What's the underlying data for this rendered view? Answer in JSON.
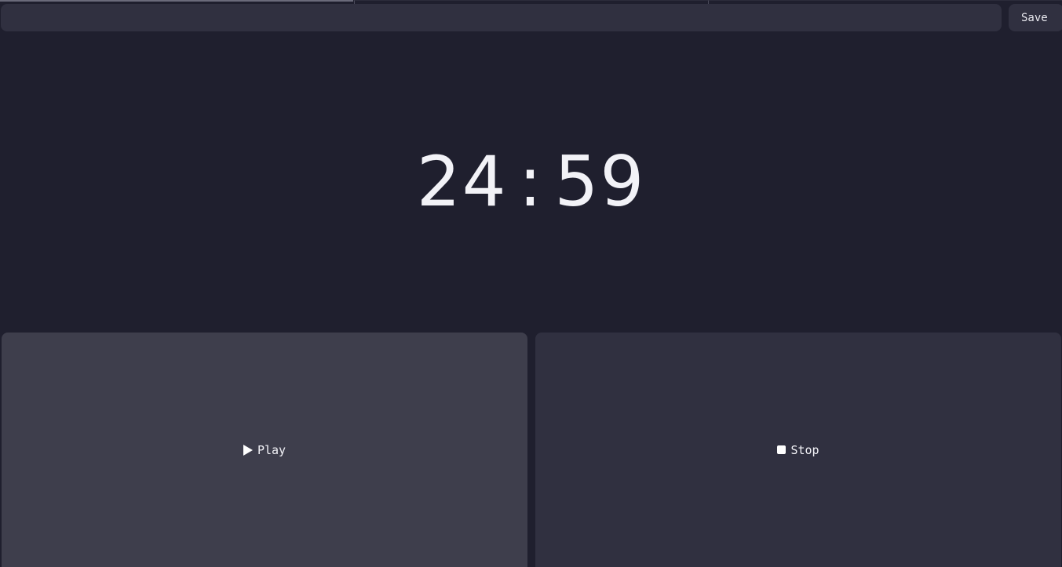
{
  "task": {
    "value": "",
    "placeholder": ""
  },
  "toolbar": {
    "save_label": "Save"
  },
  "timer": {
    "minutes": "24",
    "separator": ":",
    "seconds": "59"
  },
  "controls": {
    "play_label": "Play",
    "play_icon": "play-icon",
    "stop_label": "Stop",
    "stop_icon": "stop-icon"
  },
  "colors": {
    "background": "#1f1f2e",
    "surface": "#303040",
    "surface_active": "#3e3e4c",
    "text": "#f2f2f7"
  }
}
